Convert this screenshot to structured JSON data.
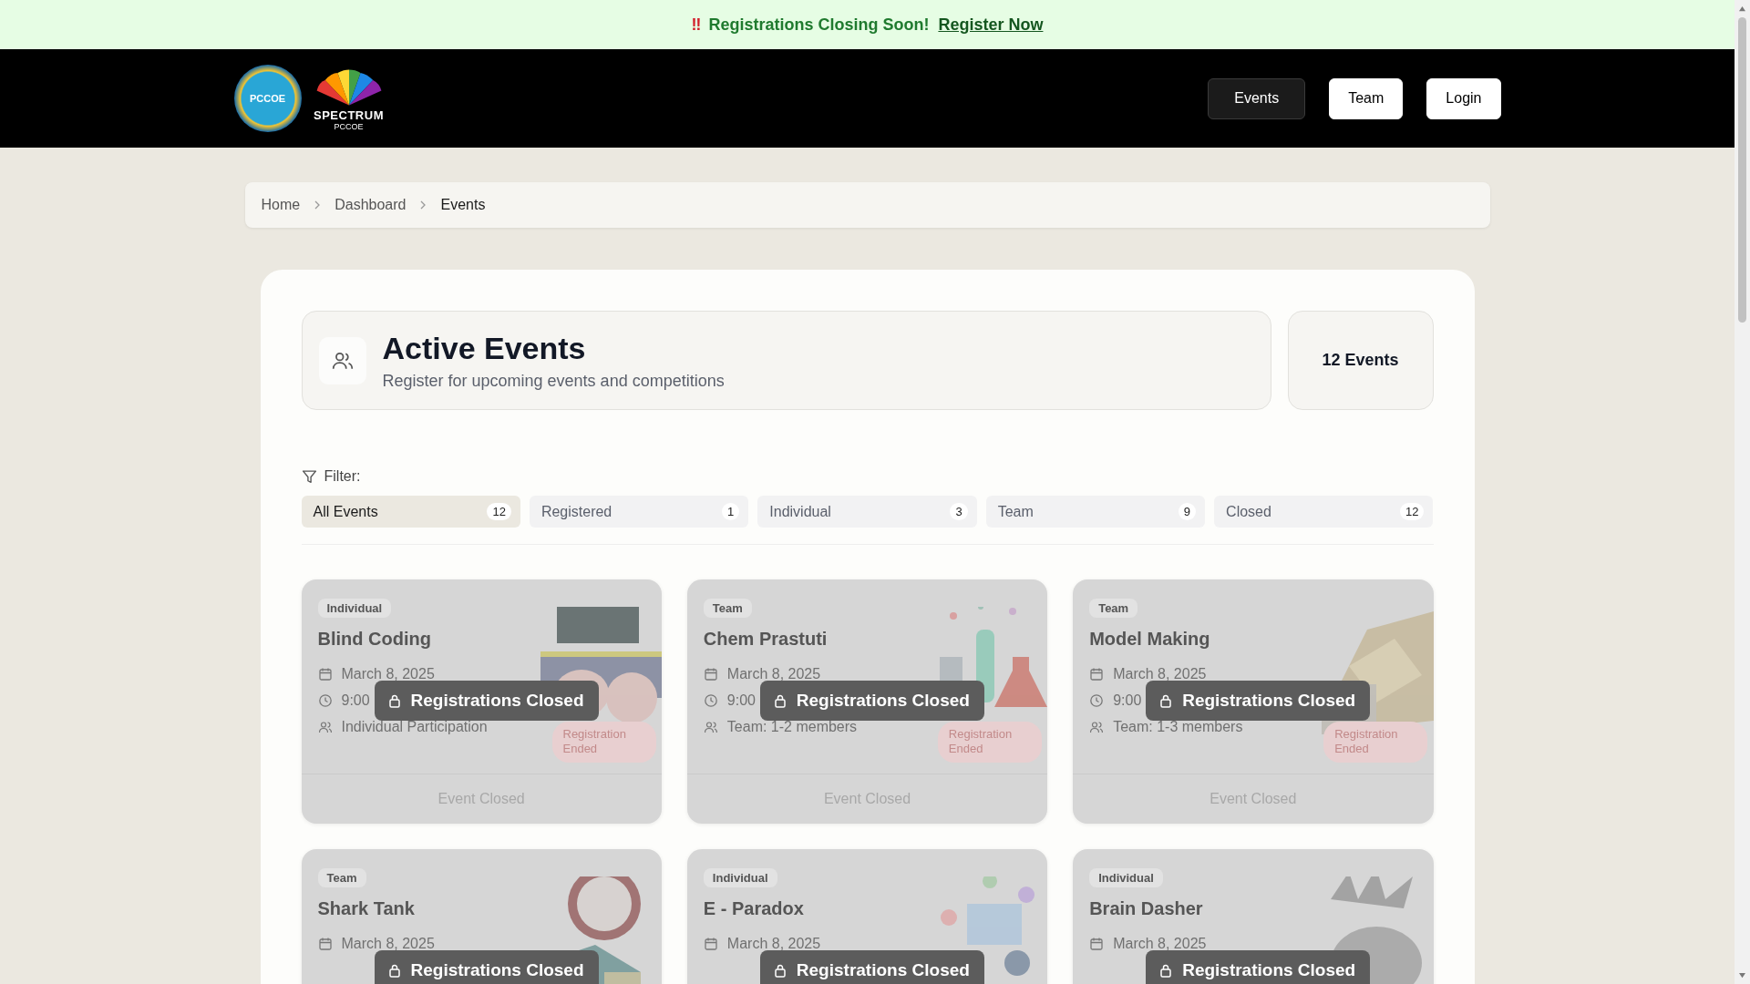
{
  "banner": {
    "icon": "‼",
    "text": "Registrations Closing Soon!",
    "link": "Register Now"
  },
  "logos": [
    {
      "text": "PCCOE"
    },
    {
      "text": "SPECTRUM",
      "subtext": "PCCOE"
    }
  ],
  "nav_buttons": [
    {
      "label": "Events",
      "selected": true
    },
    {
      "label": "Team",
      "selected": false
    },
    {
      "label": "Login",
      "selected": false
    }
  ],
  "breadcrumb": [
    {
      "label": "Home",
      "current": false
    },
    {
      "label": "Dashboard",
      "current": false
    },
    {
      "label": "Events",
      "current": true
    }
  ],
  "header": {
    "title": "Active Events",
    "subtitle": "Register for upcoming events and competitions",
    "count": "12 Events"
  },
  "filter": {
    "label": "Filter:",
    "chips": [
      {
        "label": "All Events",
        "count": "12",
        "selected": true
      },
      {
        "label": "Registered",
        "count": "1",
        "selected": false
      },
      {
        "label": "Individual",
        "count": "3",
        "selected": false
      },
      {
        "label": "Team",
        "count": "9",
        "selected": false
      },
      {
        "label": "Closed",
        "count": "12",
        "selected": false
      }
    ]
  },
  "events": [
    {
      "type": "Individual",
      "title": "Blind Coding",
      "date": "March 8, 2025",
      "time": "9:00",
      "participation": "Individual Participation",
      "status": "Registration Ended",
      "overlay": "Registrations Closed",
      "footer": "Event Closed"
    },
    {
      "type": "Team",
      "title": "Chem Prastuti",
      "date": "March 8, 2025",
      "time": "9:00",
      "participation": "Team: 1-2 members",
      "status": "Registration Ended",
      "overlay": "Registrations Closed",
      "footer": "Event Closed"
    },
    {
      "type": "Team",
      "title": "Model Making",
      "date": "March 8, 2025",
      "time": "9:00",
      "participation": "Team: 1-3 members",
      "status": "Registration Ended",
      "overlay": "Registrations Closed",
      "footer": "Event Closed"
    },
    {
      "type": "Team",
      "title": "Shark Tank",
      "date": "March 8, 2025",
      "overlay": "Registrations Closed"
    },
    {
      "type": "Individual",
      "title": "E - Paradox",
      "date": "March 8, 2025",
      "overlay": "Registrations Closed"
    },
    {
      "type": "Individual",
      "title": "Brain Dasher",
      "date": "March 8, 2025",
      "overlay": "Registrations Closed"
    }
  ]
}
